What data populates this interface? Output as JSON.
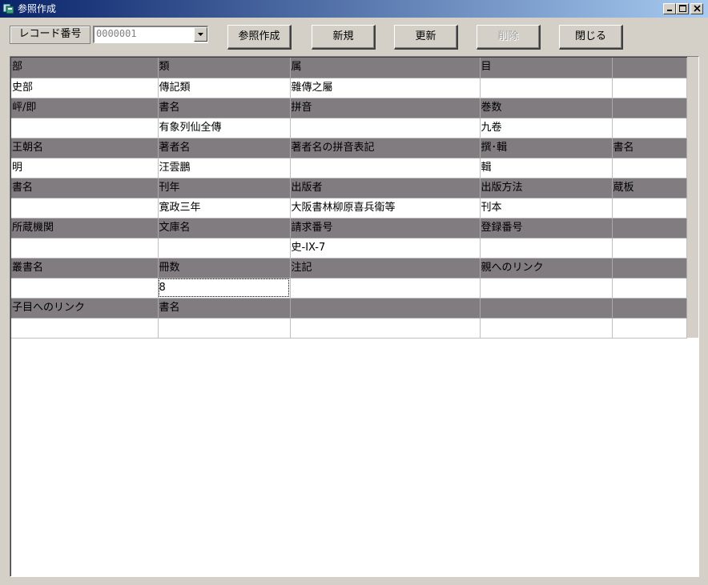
{
  "window": {
    "title": "参照作成",
    "minimize_glyph": "_",
    "maximize_glyph": "□",
    "close_glyph": "×"
  },
  "toolbar": {
    "record_label": "レコード番号",
    "record_value": "0000001",
    "buttons": {
      "create_ref": "参照作成",
      "new": "新規",
      "update": "更新",
      "delete": "削除",
      "close": "閉じる"
    }
  },
  "grid": {
    "rows": [
      {
        "type": "hdr",
        "cells": [
          "部",
          "類",
          "属",
          "目",
          ""
        ]
      },
      {
        "type": "val",
        "cells": [
          "史部",
          "傳記類",
          "雜傳之屬",
          "",
          ""
        ]
      },
      {
        "type": "hdr",
        "cells": [
          "岼/即",
          "書名",
          "拼音",
          "巻数",
          ""
        ]
      },
      {
        "type": "val",
        "cells": [
          "",
          "有象列仙全傳",
          "",
          "九卷",
          ""
        ]
      },
      {
        "type": "hdr",
        "cells": [
          "王朝名",
          "著者名",
          "著者名の拼音表記",
          "撰･輯",
          "書名"
        ]
      },
      {
        "type": "val",
        "cells": [
          "明",
          "汪雲鵬",
          "",
          "輯",
          ""
        ]
      },
      {
        "type": "hdr",
        "cells": [
          "書名",
          "刊年",
          "出版者",
          "出版方法",
          "蔵板"
        ]
      },
      {
        "type": "val",
        "cells": [
          "",
          "寛政三年",
          "大阪書林柳原喜兵衛等",
          "刊本",
          ""
        ]
      },
      {
        "type": "hdr",
        "cells": [
          "所蔵機関",
          "文庫名",
          "請求番号",
          "登録番号",
          ""
        ]
      },
      {
        "type": "val",
        "cells": [
          "",
          "",
          "史-IX-7",
          "",
          ""
        ]
      },
      {
        "type": "hdr",
        "cells": [
          "叢書名",
          "冊数",
          "注記",
          "親へのリンク",
          ""
        ]
      },
      {
        "type": "val",
        "cells": [
          "",
          "8",
          "",
          "",
          ""
        ]
      },
      {
        "type": "hdr",
        "cells": [
          "子目へのリンク",
          "書名",
          "",
          "",
          ""
        ]
      },
      {
        "type": "val",
        "cells": [
          "",
          "",
          "",
          "",
          ""
        ]
      }
    ]
  }
}
